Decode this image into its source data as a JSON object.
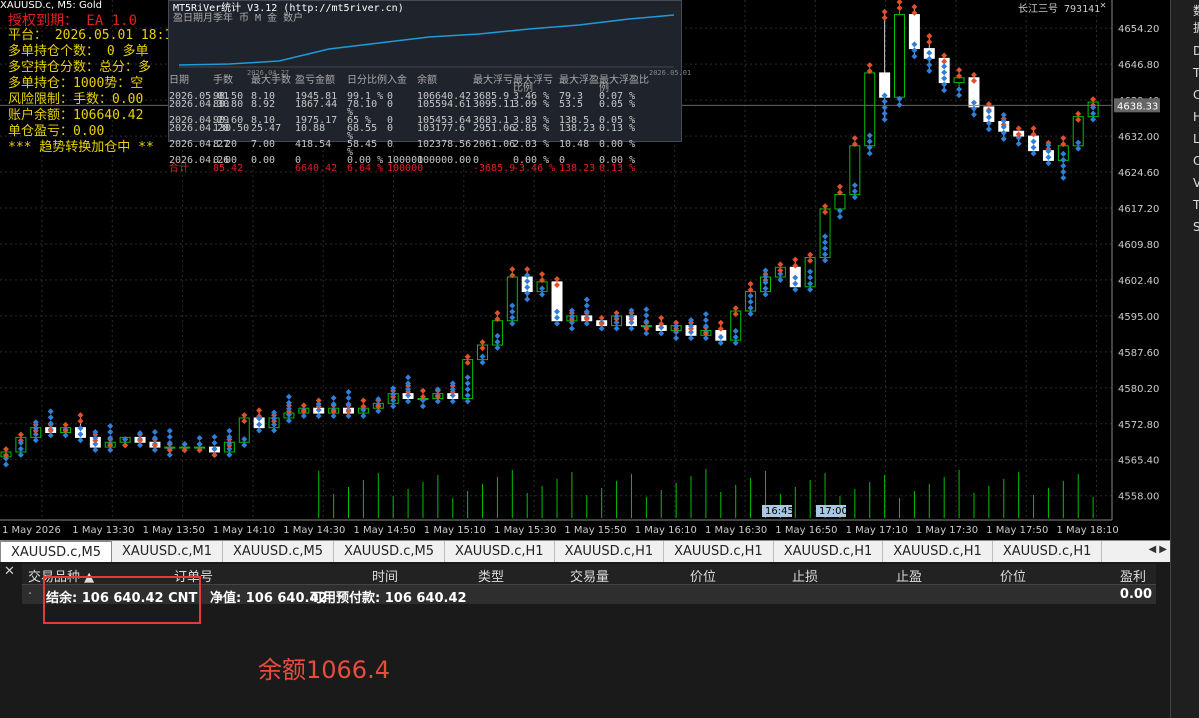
{
  "window": {
    "title": "XAUUSD.c, M5:  Gold",
    "account": "长江三号 793141"
  },
  "colors": {
    "up": "#00c000",
    "down": "#ffffff",
    "grid": "#2b2b2b",
    "axis": "#888888",
    "equity": "#1e9bd8",
    "accent": "#e53a3a"
  },
  "overlay": {
    "expired": "授权到期： EA 1.0",
    "platform": "平台： 2026.05.01 18:1",
    "long_orders": "多单持仓个数： 0  多单",
    "line3": "多空持仓分数：总分：多",
    "line4": "多单持仓：1000势：空",
    "risk": "风险限制：手数：0.00",
    "balance": "账户余额：106640.42",
    "pnl": "单仓盈亏：0.00",
    "trend": "*** 趋势转换加仓中 **"
  },
  "panel": {
    "title": "MT5RiVer统计 V3.12 (http://mt5river.cn)",
    "subtitle": "盈日期月季年 币 M 金 数户",
    "x_start": "2026.04.27",
    "x_end": "2026.05.01",
    "headers": [
      "日期",
      "手数",
      "最大手数",
      "盈亏金额",
      "日分比例",
      "入金",
      "余额",
      "最大浮亏",
      "最大浮亏比例",
      "最大浮盈",
      "最大浮盈比例"
    ],
    "rows": [
      [
        "2026.05.01",
        "98.50",
        "8.10",
        "1945.81",
        "99.1 %",
        "0",
        "106640.42",
        "3685.9",
        "3.46 %",
        "79.3",
        "0.07 %"
      ],
      [
        "2026.04.30",
        "80.80",
        "8.92",
        "1867.44",
        "78.10 %",
        "0",
        "105594.61",
        "3095.11",
        "3.09 %",
        "53.5",
        "0.05 %"
      ],
      [
        "2026.04.29",
        "90.60",
        "8.10",
        "1975.17",
        "65 %",
        "0",
        "105453.64",
        "3683.1",
        "3.83 %",
        "138.5",
        "0.05 %"
      ],
      [
        "2026.04.28",
        "130.50",
        "25.47",
        "10.88",
        "68.55 %",
        "0",
        "103177.6",
        "2951.06",
        "2.85 %",
        "138.23",
        "0.13 %"
      ],
      [
        "2026.04.27",
        "8.20",
        "7.00",
        "418.54",
        "58.45 %",
        "0",
        "102378.56",
        "2061.06",
        "2.03 %",
        "10.48",
        "0.00 %"
      ],
      [
        "2026.04.26",
        "0.00",
        "0.00",
        "0",
        "0.00 %",
        "100000",
        "100000.00",
        "0",
        "0.00 %",
        "0",
        "0.00 %"
      ]
    ],
    "total": [
      "合计",
      "85.42",
      "",
      "6640.42",
      "6.64 %",
      "100000",
      "",
      "-3685.9",
      "-3.46 %",
      "138.23",
      "0.13 %"
    ]
  },
  "chart_data": {
    "type": "candlestick",
    "x_ticks": [
      "1 May 2026",
      "1 May 13:30",
      "1 May 13:50",
      "1 May 14:10",
      "1 May 14:30",
      "1 May 14:50",
      "1 May 15:10",
      "1 May 15:30",
      "1 May 15:50",
      "1 May 16:10",
      "1 May 16:30",
      "1 May 16:50",
      "1 May 17:10",
      "1 May 17:30",
      "1 May 17:50",
      "1 May 18:10"
    ],
    "y_ticks": [
      "4654.20",
      "4646.80",
      "4639.40",
      "4632.00",
      "4624.60",
      "4617.20",
      "4609.80",
      "4602.40",
      "4595.00",
      "4587.60",
      "4580.20",
      "4572.80",
      "4565.40",
      "4558.00"
    ],
    "current_price": "4638.33",
    "time_markers": [
      "16:45",
      "17:00"
    ],
    "ylim": [
      4553,
      4660
    ],
    "candles": [
      [
        4566,
        4568,
        4564,
        4567
      ],
      [
        4567,
        4571,
        4566,
        4570
      ],
      [
        4570,
        4573,
        4569,
        4572
      ],
      [
        4572,
        4573,
        4570,
        4571
      ],
      [
        4571,
        4573,
        4570,
        4572
      ],
      [
        4572,
        4575,
        4569,
        4570
      ],
      [
        4570,
        4571,
        4567,
        4568
      ],
      [
        4568,
        4570,
        4567,
        4569
      ],
      [
        4569,
        4570,
        4568,
        4570
      ],
      [
        4570,
        4571,
        4568,
        4569
      ],
      [
        4569,
        4570,
        4567,
        4568
      ],
      [
        4568,
        4569,
        4566,
        4568
      ],
      [
        4568,
        4569,
        4567,
        4568
      ],
      [
        4568,
        4569,
        4567,
        4568
      ],
      [
        4568,
        4568,
        4566,
        4567
      ],
      [
        4567,
        4570,
        4566,
        4569
      ],
      [
        4569,
        4575,
        4568,
        4574
      ],
      [
        4574,
        4576,
        4571,
        4572
      ],
      [
        4572,
        4575,
        4571,
        4574
      ],
      [
        4574,
        4577,
        4573,
        4575
      ],
      [
        4575,
        4577,
        4574,
        4576
      ],
      [
        4576,
        4578,
        4574,
        4575
      ],
      [
        4575,
        4577,
        4574,
        4576
      ],
      [
        4576,
        4577,
        4574,
        4575
      ],
      [
        4575,
        4578,
        4574,
        4576
      ],
      [
        4576,
        4578,
        4575,
        4577
      ],
      [
        4577,
        4580,
        4576,
        4579
      ],
      [
        4579,
        4581,
        4577,
        4578
      ],
      [
        4578,
        4580,
        4576,
        4578
      ],
      [
        4578,
        4580,
        4577,
        4579
      ],
      [
        4579,
        4581,
        4577,
        4578
      ],
      [
        4578,
        4587,
        4577,
        4586
      ],
      [
        4586,
        4590,
        4585,
        4589
      ],
      [
        4589,
        4596,
        4588,
        4594
      ],
      [
        4594,
        4605,
        4593,
        4603
      ],
      [
        4603,
        4605,
        4598,
        4600
      ],
      [
        4600,
        4604,
        4599,
        4602
      ],
      [
        4602,
        4603,
        4593,
        4594
      ],
      [
        4594,
        4596,
        4592,
        4595
      ],
      [
        4595,
        4596,
        4593,
        4594
      ],
      [
        4594,
        4595,
        4592,
        4593
      ],
      [
        4593,
        4596,
        4592,
        4595
      ],
      [
        4595,
        4596,
        4592,
        4593
      ],
      [
        4593,
        4594,
        4591,
        4593
      ],
      [
        4593,
        4595,
        4591,
        4592
      ],
      [
        4592,
        4594,
        4590,
        4593
      ],
      [
        4593,
        4594,
        4590,
        4591
      ],
      [
        4591,
        4593,
        4590,
        4592
      ],
      [
        4592,
        4594,
        4589,
        4590
      ],
      [
        4590,
        4597,
        4589,
        4596
      ],
      [
        4596,
        4602,
        4595,
        4600
      ],
      [
        4600,
        4604,
        4599,
        4603
      ],
      [
        4603,
        4606,
        4602,
        4605
      ],
      [
        4605,
        4607,
        4600,
        4601
      ],
      [
        4601,
        4608,
        4600,
        4607
      ],
      [
        4607,
        4618,
        4606,
        4617
      ],
      [
        4617,
        4622,
        4615,
        4620
      ],
      [
        4620,
        4632,
        4619,
        4630
      ],
      [
        4630,
        4647,
        4628,
        4645
      ],
      [
        4645,
        4658,
        4635,
        4640
      ],
      [
        4640,
        4660,
        4638,
        4657
      ],
      [
        4657,
        4659,
        4648,
        4650
      ],
      [
        4650,
        4653,
        4645,
        4648
      ],
      [
        4648,
        4649,
        4641,
        4643
      ],
      [
        4643,
        4646,
        4640,
        4644
      ],
      [
        4644,
        4645,
        4636,
        4638
      ],
      [
        4638,
        4639,
        4633,
        4635
      ],
      [
        4635,
        4636,
        4631,
        4633
      ],
      [
        4633,
        4634,
        4630,
        4632
      ],
      [
        4632,
        4634,
        4628,
        4629
      ],
      [
        4629,
        4631,
        4626,
        4627
      ],
      [
        4627,
        4632,
        4623,
        4630
      ],
      [
        4630,
        4637,
        4629,
        4636
      ],
      [
        4636,
        4640,
        4635,
        4639
      ]
    ]
  },
  "tabs": [
    "XAUUSD.c,M5",
    "XAUUSD.c,M1",
    "XAUUSD.c,M5",
    "XAUUSD.c,M5",
    "XAUUSD.c,H1",
    "XAUUSD.c,H1",
    "XAUUSD.c,H1",
    "XAUUSD.c,H1",
    "XAUUSD.c,H1",
    "XAUUSD.c,H1"
  ],
  "terminal": {
    "close_glyph": "✕",
    "columns": [
      "交易品种",
      "订单号",
      "时间",
      "类型",
      "交易量",
      "价位",
      "止损",
      "止盈",
      "价位",
      "盈利"
    ],
    "sort_arrow": "▲",
    "row_balance": "结余: 106 640.42 CNT",
    "row_equity": "净值: 106 640.42",
    "row_free": "可用预付款: 106 640.42",
    "row_profit": "0.00"
  },
  "annotation": {
    "note": "余额1066.4"
  },
  "right_column": [
    "数据",
    "D",
    "T",
    "C",
    "H",
    "L",
    "C",
    "V",
    "T",
    "S"
  ]
}
